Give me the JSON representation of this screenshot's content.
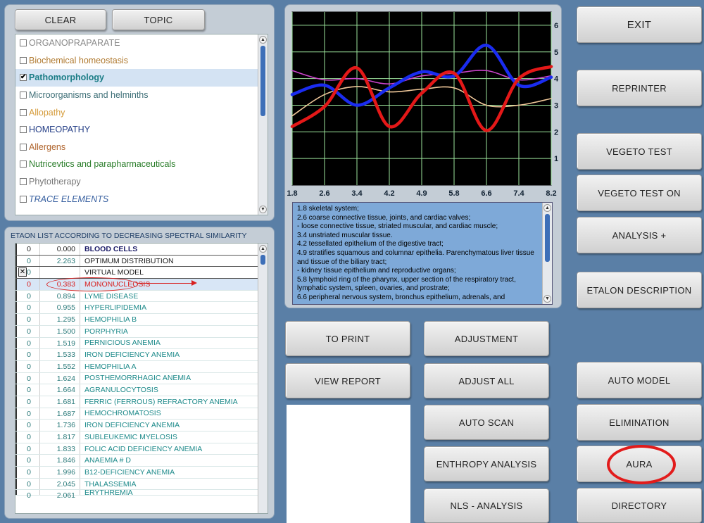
{
  "topic_panel": {
    "clear_label": "CLEAR",
    "topic_label": "TOPIC",
    "items": [
      {
        "label": "ORGANOPRAPARATE",
        "color": "#8a8a8a",
        "checked": false
      },
      {
        "label": "Biochemical homeostasis",
        "color": "#b07a30",
        "checked": false
      },
      {
        "label": "Pathomorphology",
        "color": "#1b7d86",
        "checked": true
      },
      {
        "label": "Microorganisms and helminths",
        "color": "#3e6f77",
        "checked": false
      },
      {
        "label": "Allopathy",
        "color": "#d59b3a",
        "checked": false
      },
      {
        "label": "HOMEOPATHY",
        "color": "#243e86",
        "checked": false
      },
      {
        "label": "Allergens",
        "color": "#b0652e",
        "checked": false
      },
      {
        "label": "Nutricevtics and parapharmaceuticals",
        "color": "#2a7d2a",
        "checked": false
      },
      {
        "label": "Phytotherapy",
        "color": "#777",
        "checked": false
      },
      {
        "label": "TRACE ELEMENTS",
        "color": "#3860a0",
        "checked": false
      }
    ]
  },
  "etalon_panel": {
    "header": "ETAON LIST ACCORDING TO DECREASING SPECTRAL SIMILARITY",
    "rows": [
      {
        "flag": "0",
        "value": "0.000",
        "name": "BLOOD  CELLS"
      },
      {
        "flag": "0",
        "value": "2.263",
        "name": "OPTIMUM DISTRIBUTION"
      },
      {
        "flag": "0",
        "value": "",
        "name": "VIRTUAL MODEL"
      },
      {
        "flag": "0",
        "value": "0.383",
        "name": "MONONUCLEOSIS"
      },
      {
        "flag": "0",
        "value": "0.894",
        "name": "LYME DISEASE"
      },
      {
        "flag": "0",
        "value": "0.955",
        "name": "HYPERLIPIDEMIA"
      },
      {
        "flag": "0",
        "value": "1.295",
        "name": "HEMOPHILIA B"
      },
      {
        "flag": "0",
        "value": "1.500",
        "name": "PORPHYRIA"
      },
      {
        "flag": "0",
        "value": "1.519",
        "name": "PERNICIOUS ANEMIA"
      },
      {
        "flag": "0",
        "value": "1.533",
        "name": "IRON DEFICIENCY ANEMIA"
      },
      {
        "flag": "0",
        "value": "1.552",
        "name": "HEMOPHILIA A"
      },
      {
        "flag": "0",
        "value": "1.624",
        "name": "POSTHEMORRHAGIC  ANEMIA"
      },
      {
        "flag": "0",
        "value": "1.664",
        "name": "AGRANULOCYTOSIS"
      },
      {
        "flag": "0",
        "value": "1.681",
        "name": "FERRIC  (FERROUS)  REFRACTORY   ANEMIA"
      },
      {
        "flag": "0",
        "value": "1.687",
        "name": "HEMOCHROMATOSIS"
      },
      {
        "flag": "0",
        "value": "1.736",
        "name": "IRON  DEFICIENCY  ANEMIA"
      },
      {
        "flag": "0",
        "value": "1.817",
        "name": "SUBLEUKEMIC  MYELOSIS"
      },
      {
        "flag": "0",
        "value": "1.833",
        "name": "FOLIC  ACID DEFICIENCY  ANEMIA"
      },
      {
        "flag": "0",
        "value": "1.846",
        "name": "ANAEMIA # D"
      },
      {
        "flag": "0",
        "value": "1.996",
        "name": "B12-DEFICIENCY  ANEMIA"
      },
      {
        "flag": "0",
        "value": "2.045",
        "name": "THALASSEMIA"
      },
      {
        "flag": "0",
        "value": "2.061",
        "name": "ERYTHREMIA"
      }
    ]
  },
  "chart_data": {
    "type": "line",
    "x_ticks": [
      "1.8",
      "2.6",
      "3.4",
      "4.2",
      "4.9",
      "5.8",
      "6.6",
      "7.4",
      "8.2"
    ],
    "y_ticks": [
      "1",
      "2",
      "3",
      "4",
      "5",
      "6"
    ],
    "ylim": [
      0,
      6.5
    ],
    "grid": true,
    "background": "#000000",
    "grid_color": "#9be39b",
    "series": [
      {
        "color": "#1a2cf0",
        "values": [
          3.4,
          3.75,
          3.0,
          3.65,
          4.25,
          4.1,
          5.25,
          3.75,
          4.05
        ]
      },
      {
        "color": "#e41818",
        "values": [
          2.2,
          2.95,
          4.4,
          2.2,
          3.45,
          4.2,
          2.05,
          4.0,
          4.45
        ]
      },
      {
        "color": "#cc44cc",
        "values": [
          4.3,
          3.95,
          4.0,
          3.8,
          4.1,
          4.2,
          4.3,
          3.95,
          4.1
        ]
      },
      {
        "color": "#f0c89a",
        "values": [
          2.6,
          3.4,
          3.7,
          3.5,
          3.6,
          3.65,
          3.0,
          3.0,
          3.25
        ]
      }
    ]
  },
  "legend_lines": [
    "1.8 skeletal system;",
    "2.6 coarse connective tissue, joints, and cardiac valves;",
    "- loose connective tissue, striated muscular, and cardiac muscle;",
    "3.4 unstriated muscular tissue.",
    "4.2 tessellated epithelium of the digestive tract;",
    "4.9 stratifies squamous and columnar epithelia. Parenchymatous liver tissue and tissue of the biliary tract;",
    "- kidney tissue epithelium and reproductive organs;",
    "5.8 lymphoid ring of the pharynx, upper section of the respiratory tract, lymphatic system, spleen, ovaries, and prostrate;",
    "6.6 peripheral nervous system, bronchus epithelium, adrenals, and"
  ],
  "middle_buttons": {
    "to_print": "TO PRINT",
    "view_report": "VIEW REPORT",
    "adjustment": "ADJUSTMENT",
    "adjust_all": "ADJUST ALL",
    "auto_scan": "AUTO SCAN",
    "enthropy": "ENTHROPY ANALYSIS",
    "nls": "NLS - ANALYSIS"
  },
  "right_buttons": {
    "exit": "EXIT",
    "reprinter": "REPRINTER",
    "vegeto_test": "VEGETO TEST",
    "vegeto_test_on": "VEGETO TEST ON",
    "analysis_plus": "ANALYSIS +",
    "etalon_description": "ETALON DESCRIPTION",
    "auto_model": "AUTO MODEL",
    "elimination": "ELIMINATION",
    "aura": "AURA",
    "directory": "DIRECTORY"
  }
}
